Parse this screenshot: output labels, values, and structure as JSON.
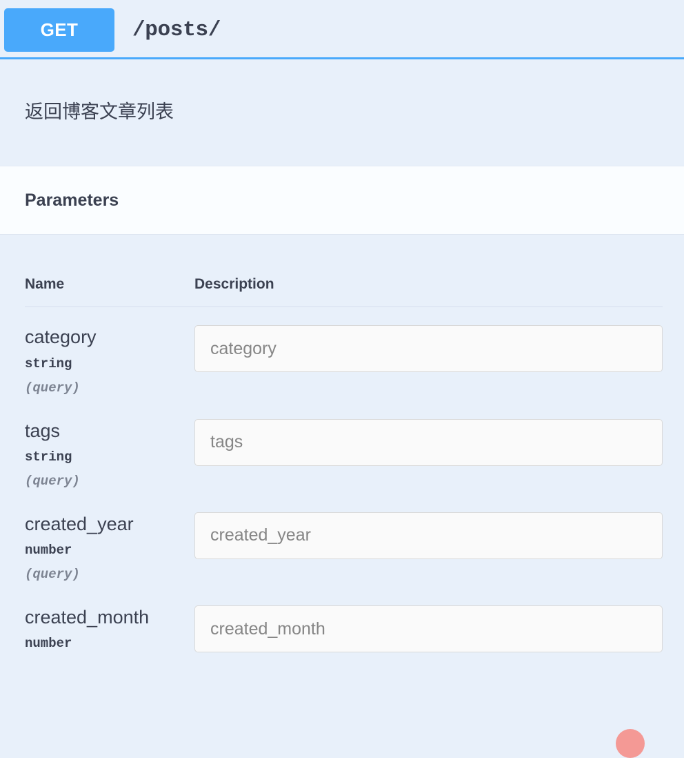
{
  "operation": {
    "method": "GET",
    "path": "/posts/",
    "description": "返回博客文章列表"
  },
  "parameters_section": {
    "title": "Parameters",
    "columns": {
      "name": "Name",
      "description": "Description"
    },
    "rows": [
      {
        "name": "category",
        "type": "string",
        "in": "(query)",
        "input_value": "",
        "placeholder": "category"
      },
      {
        "name": "tags",
        "type": "string",
        "in": "(query)",
        "input_value": "",
        "placeholder": "tags"
      },
      {
        "name": "created_year",
        "type": "number",
        "in": "(query)",
        "input_value": "",
        "placeholder": "created_year"
      },
      {
        "name": "created_month",
        "type": "number",
        "in": "",
        "input_value": "",
        "placeholder": "created_month"
      }
    ]
  },
  "colors": {
    "method_get": "#49a9fb",
    "page_background": "#e8f0fa",
    "band_background": "#fafdff",
    "text_primary": "#3b4151",
    "text_muted": "#7d8492",
    "cursor": "#f4938f"
  }
}
